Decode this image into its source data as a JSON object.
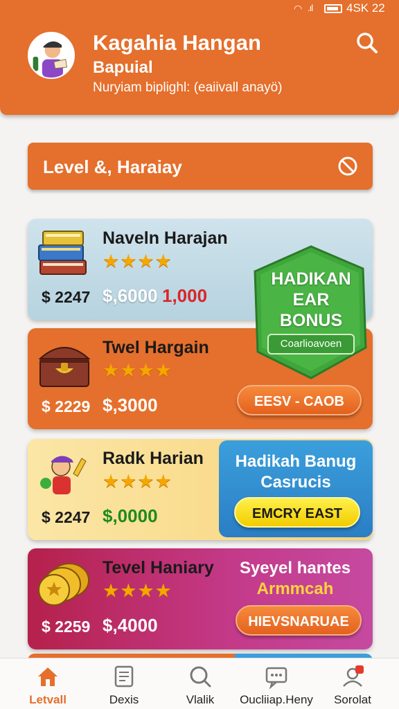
{
  "status": {
    "time": "4SK 22"
  },
  "header": {
    "title": "Kagahia Hangan",
    "subtitle": "Bapuial",
    "line": "Nuryiam biplighl:   (eaiivall anayö)"
  },
  "level_bar": {
    "label": "Level &, Haraiay"
  },
  "cards": [
    {
      "name": "Naveln Harajan",
      "stars": "★★★★",
      "price": "$ 2247",
      "price2": "$,6000",
      "price3": "1,000"
    },
    {
      "name": "Twel Hargain",
      "stars": "★★★★",
      "price": "$ 2229",
      "price2": "$,3000",
      "button": "EESV - CAOB"
    },
    {
      "name": "Radk Harian",
      "stars": "★★★★",
      "price": "$ 2247",
      "price2": "$,0000"
    },
    {
      "name": "Tevel Haniary",
      "stars": "★★★★",
      "price": "$ 2259",
      "price2": "$,4000"
    }
  ],
  "badge": {
    "line1": "HADIKAN",
    "line2": "EAR",
    "line3": "BONUS",
    "button": "Coarlioavoen"
  },
  "promo_blue": {
    "line1": "Hadikah Banug",
    "line2": "Casrucis",
    "button": "EMCRY EAST"
  },
  "promo_purple": {
    "line1": "Syeyel hantes",
    "line2": "Armmcah",
    "button": "HIEVSNARUAE"
  },
  "tabs": [
    {
      "label": "Letvall",
      "icon": "home-icon"
    },
    {
      "label": "Dexis",
      "icon": "document-icon"
    },
    {
      "label": "Vlalik",
      "icon": "search-icon"
    },
    {
      "label": "Oucliiap.Heny",
      "icon": "chat-icon"
    },
    {
      "label": "Sorolat",
      "icon": "profile-icon"
    }
  ],
  "colors": {
    "primary": "#e56f2c",
    "blue": "#3b9fdc",
    "green": "#3a9b36",
    "yellow": "#f2cc00",
    "purple": "#c43a8a"
  }
}
